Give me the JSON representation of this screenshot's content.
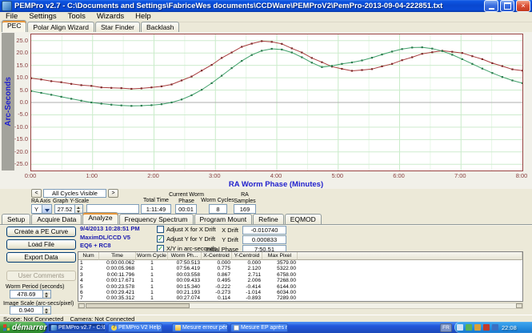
{
  "window": {
    "title": "PEMPro v2.7 - C:\\Documents and Settings\\FabriceWes documents\\CCDWare\\PEMProV2\\PemPro-2013-09-04-222851.txt",
    "menu": [
      "File",
      "Settings",
      "Tools",
      "Wizards",
      "Help"
    ],
    "top_tabs": [
      {
        "label": "PEC",
        "active": true
      },
      {
        "label": "Polar Align Wizard",
        "active": false
      },
      {
        "label": "Star Finder",
        "active": false
      },
      {
        "label": "Backlash",
        "active": false
      }
    ]
  },
  "chart_data": {
    "type": "line",
    "title": "",
    "xlabel": "RA Worm Phase (Minutes)",
    "ylabel": "Arc-Seconds",
    "xlim": [
      0,
      8
    ],
    "ylim": [
      -27.52,
      27.52
    ],
    "x_ticks": [
      "0:00",
      "1:00",
      "2:00",
      "3:00",
      "4:00",
      "5:00",
      "6:00",
      "7:00",
      "8:00"
    ],
    "y_ticks": [
      25,
      20,
      15,
      10,
      5,
      0,
      -5,
      -10,
      -15,
      -20,
      -25
    ],
    "grid": true,
    "legend": "none",
    "series": [
      {
        "name": "ra-periodic-error-red",
        "color": "#a83c3c",
        "marker": "#7d2a2a",
        "x": [
          0,
          0.163,
          0.327,
          0.49,
          0.653,
          0.816,
          0.98,
          1.143,
          1.306,
          1.469,
          1.633,
          1.796,
          1.959,
          2.122,
          2.286,
          2.449,
          2.612,
          2.776,
          2.939,
          3.102,
          3.265,
          3.429,
          3.592,
          3.755,
          3.918,
          4.082,
          4.245,
          4.408,
          4.571,
          4.735,
          4.898,
          5.061,
          5.224,
          5.388,
          5.551,
          5.714,
          5.878,
          6.041,
          6.204,
          6.367,
          6.531,
          6.694,
          6.857,
          7.02,
          7.184,
          7.347,
          7.51,
          7.673,
          7.837,
          8.0
        ],
        "values": [
          9.8,
          9.3,
          8.6,
          8.2,
          7.5,
          7.0,
          6.7,
          6.1,
          5.9,
          5.8,
          5.5,
          5.7,
          6.1,
          6.5,
          7.3,
          8.9,
          10.5,
          12.9,
          15.2,
          18.0,
          20.2,
          22.5,
          23.8,
          24.8,
          24.5,
          23.7,
          21.9,
          20.2,
          18.0,
          16.3,
          14.5,
          13.6,
          12.8,
          13.1,
          13.5,
          14.6,
          15.6,
          17.1,
          18.3,
          19.7,
          20.3,
          20.9,
          20.5,
          20.0,
          18.7,
          17.5,
          15.9,
          14.7,
          13.4,
          12.9
        ]
      },
      {
        "name": "ra-periodic-error-green",
        "color": "#3fa06a",
        "marker": "#2b7a4d",
        "x": [
          0,
          0.163,
          0.327,
          0.49,
          0.653,
          0.816,
          0.98,
          1.143,
          1.306,
          1.469,
          1.633,
          1.796,
          1.959,
          2.122,
          2.286,
          2.449,
          2.612,
          2.776,
          2.939,
          3.102,
          3.265,
          3.429,
          3.592,
          3.755,
          3.918,
          4.082,
          4.245,
          4.408,
          4.571,
          4.735,
          4.898,
          5.061,
          5.224,
          5.388,
          5.551,
          5.714,
          5.878,
          6.041,
          6.204,
          6.367,
          6.531,
          6.694,
          6.857,
          7.02,
          7.184,
          7.347,
          7.51,
          7.673,
          7.837,
          8.0
        ],
        "values": [
          4.6,
          3.9,
          3.1,
          2.3,
          1.5,
          0.7,
          0.0,
          -0.5,
          -0.9,
          -1.2,
          -1.4,
          -1.3,
          -1.1,
          -0.7,
          0.0,
          1.2,
          2.9,
          5.1,
          7.8,
          10.8,
          13.9,
          16.8,
          19.2,
          20.9,
          21.7,
          21.4,
          20.2,
          18.3,
          16.1,
          14.3,
          14.8,
          15.6,
          16.2,
          17.0,
          18.1,
          19.4,
          20.6,
          21.6,
          22.2,
          22.3,
          21.8,
          20.8,
          19.3,
          17.5,
          15.6,
          13.7,
          11.9,
          10.3,
          8.9,
          7.8
        ]
      }
    ]
  },
  "chart_controls": {
    "prev_glyph": "<",
    "next_glyph": ">",
    "cycles_label": "All Cycles Visible",
    "ra_axis_label": "RA Axis",
    "ra_axis_value": "Y",
    "y_scale_label": "Graph Y-Scale",
    "y_scale_value": "27.52",
    "total_time_label": "Total Time",
    "total_time": "1:11:49",
    "worm_phase_label": "Current Worm Phase",
    "worm_phase": "00:01",
    "worm_cycles_label": "Worm Cycles",
    "worm_cycles": "8",
    "ra_samples_label": "RA Samples",
    "ra_samples": "169"
  },
  "bottom_tabs": [
    {
      "label": "Setup",
      "active": false
    },
    {
      "label": "Acquire Data",
      "active": false
    },
    {
      "label": "Analyze",
      "active": true
    },
    {
      "label": "Frequency Spectrum",
      "active": false
    },
    {
      "label": "Program Mount",
      "active": false
    },
    {
      "label": "Refine",
      "active": false
    },
    {
      "label": "EQMOD",
      "active": false
    }
  ],
  "analyze": {
    "buttons": [
      {
        "label": "Create a PE Curve",
        "disabled": false
      },
      {
        "label": "Load File",
        "disabled": false
      },
      {
        "label": "Export Data",
        "disabled": false
      },
      {
        "label": "User Comments",
        "disabled": true
      }
    ],
    "worm_period_label": "Worm Period (seconds)",
    "worm_period": "478.69",
    "image_scale_label": "Image Scale (arc-secs/pixel)",
    "image_scale": "0.940",
    "session_info": [
      "9/4/2013 10:28:51 PM",
      "MaximDL/CCD V5",
      "EQ6 + RC8"
    ],
    "checkboxes": [
      {
        "label": "Adjust X for X Drift",
        "checked": false
      },
      {
        "label": "Adjust Y for Y Drift",
        "checked": true
      },
      {
        "label": "X/Y in arc-seconds",
        "checked": true
      }
    ],
    "drift_fields": [
      {
        "label": "X Drift",
        "value": "-0.010740"
      },
      {
        "label": "Y Drift",
        "value": "0.000833"
      },
      {
        "label": "Initial Phase",
        "value": "7:50.51"
      }
    ],
    "table": {
      "columns": [
        "Num",
        "Time",
        "Worm Cycle",
        "Worm Ph...",
        "X-Centroid",
        "Y-Centroid",
        "Max Pixel"
      ],
      "rows": [
        [
          "1",
          "0:00:00.062",
          "1",
          "07:50.513",
          "0.000",
          "0.000",
          "3579.00"
        ],
        [
          "2",
          "0:00:05.968",
          "1",
          "07:56.419",
          "0.775",
          "2.120",
          "5322.00"
        ],
        [
          "3",
          "0:00:11.796",
          "1",
          "00:03.558",
          "0.867",
          "2.711",
          "6758.00"
        ],
        [
          "4",
          "0:00:17.671",
          "1",
          "00:09.433",
          "0.495",
          "2.006",
          "7268.00"
        ],
        [
          "5",
          "0:00:23.578",
          "1",
          "00:15.340",
          "-0.222",
          "-0.414",
          "6144.00"
        ],
        [
          "6",
          "0:00:29.421",
          "1",
          "00:21.193",
          "-0.273",
          "-1.014",
          "6034.00"
        ],
        [
          "7",
          "0:00:35.312",
          "1",
          "00:27.074",
          "0.114",
          "-0.893",
          "7289.00"
        ]
      ]
    }
  },
  "status_bar": {
    "scope": "Scope: Not Connected",
    "camera": "Camera: Not Connected"
  },
  "taskbar": {
    "start": "démarrer",
    "language": "FR",
    "tasks": [
      {
        "label": "PEMPro v2.7 - C:\\Doc...",
        "active": true,
        "icon": "app"
      },
      {
        "label": "PEMPro V2 Help",
        "active": false,
        "icon": "help"
      },
      {
        "label": "Mesure erreur périod...",
        "active": false,
        "icon": "folder"
      },
      {
        "label": "Mesure EP après nor...",
        "active": false,
        "icon": "window"
      }
    ],
    "tray_icons": [
      "volume-icon",
      "shield-icon",
      "network-icon",
      "alert-icon",
      "scheduler-icon"
    ],
    "tray_clock": "22:08"
  },
  "colors": {
    "titlebar_blue": "#0a47cf",
    "xp_tan": "#ece9d8",
    "axis_title_blue": "#2121cd",
    "tick_label_red": "#8b4242",
    "plot_border": "#9a4343",
    "grid_green": "#cdeccd",
    "taskbar_blue": "#2458dd",
    "start_green": "#3a9c3a"
  }
}
